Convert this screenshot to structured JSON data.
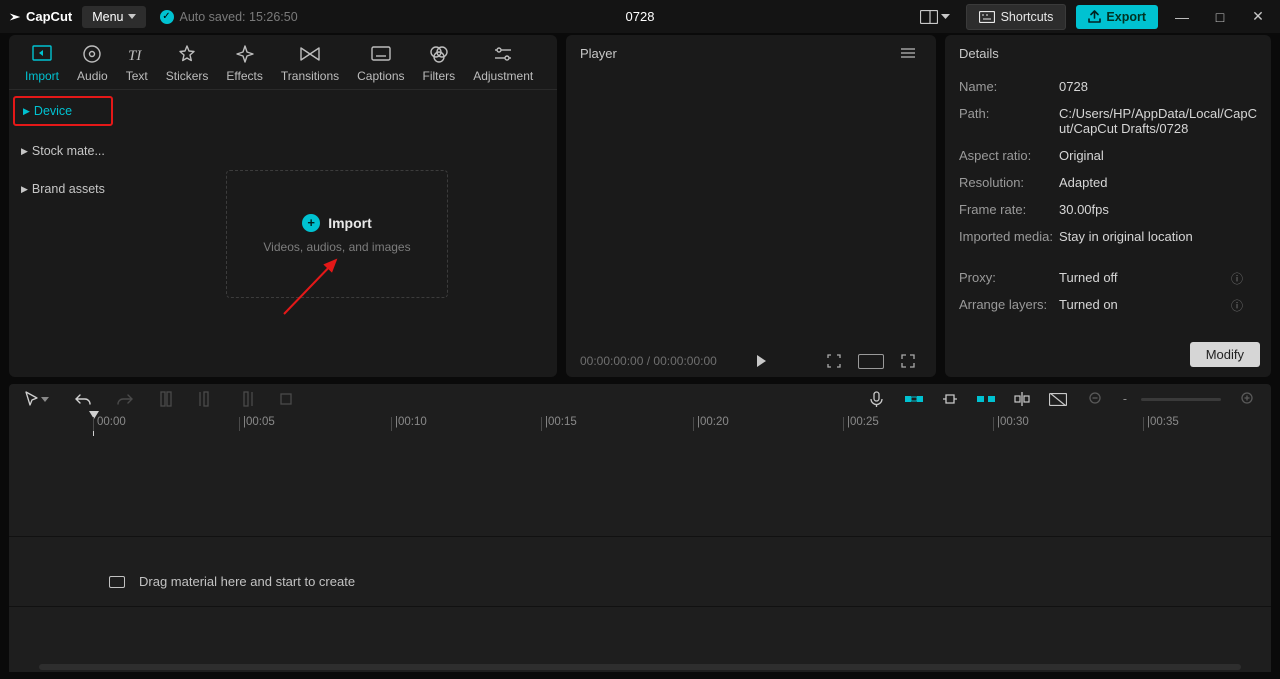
{
  "title_bar": {
    "logo": "CapCut",
    "menu": "Menu",
    "autosave": "Auto saved: 15:26:50",
    "project_name": "0728",
    "shortcuts": "Shortcuts",
    "export": "Export"
  },
  "import_tabs": {
    "items": [
      {
        "label": "Import"
      },
      {
        "label": "Audio"
      },
      {
        "label": "Text"
      },
      {
        "label": "Stickers"
      },
      {
        "label": "Effects"
      },
      {
        "label": "Transitions"
      },
      {
        "label": "Captions"
      },
      {
        "label": "Filters"
      },
      {
        "label": "Adjustment"
      }
    ]
  },
  "import_sidebar": {
    "device": "Device",
    "stock": "Stock mate...",
    "brand": "Brand assets"
  },
  "import_drop": {
    "title": "Import",
    "subtitle": "Videos, audios, and images"
  },
  "player": {
    "title": "Player",
    "time_current": "00:00:00:00",
    "time_sep": " / ",
    "time_total": "00:00:00:00"
  },
  "details": {
    "title": "Details",
    "rows": {
      "name_l": "Name:",
      "name_v": "0728",
      "path_l": "Path:",
      "path_v": "C:/Users/HP/AppData/Local/CapCut/CapCut Drafts/0728",
      "aspect_l": "Aspect ratio:",
      "aspect_v": "Original",
      "res_l": "Resolution:",
      "res_v": "Adapted",
      "fps_l": "Frame rate:",
      "fps_v": "30.00fps",
      "imp_l": "Imported media:",
      "imp_v": "Stay in original location",
      "proxy_l": "Proxy:",
      "proxy_v": "Turned off",
      "arr_l": "Arrange layers:",
      "arr_v": "Turned on"
    },
    "modify": "Modify"
  },
  "timeline": {
    "ticks": [
      "00:00",
      "|00:05",
      "|00:10",
      "|00:15",
      "|00:20",
      "|00:25",
      "|00:30",
      "|00:35"
    ],
    "drop_hint": "Drag material here and start to create"
  }
}
